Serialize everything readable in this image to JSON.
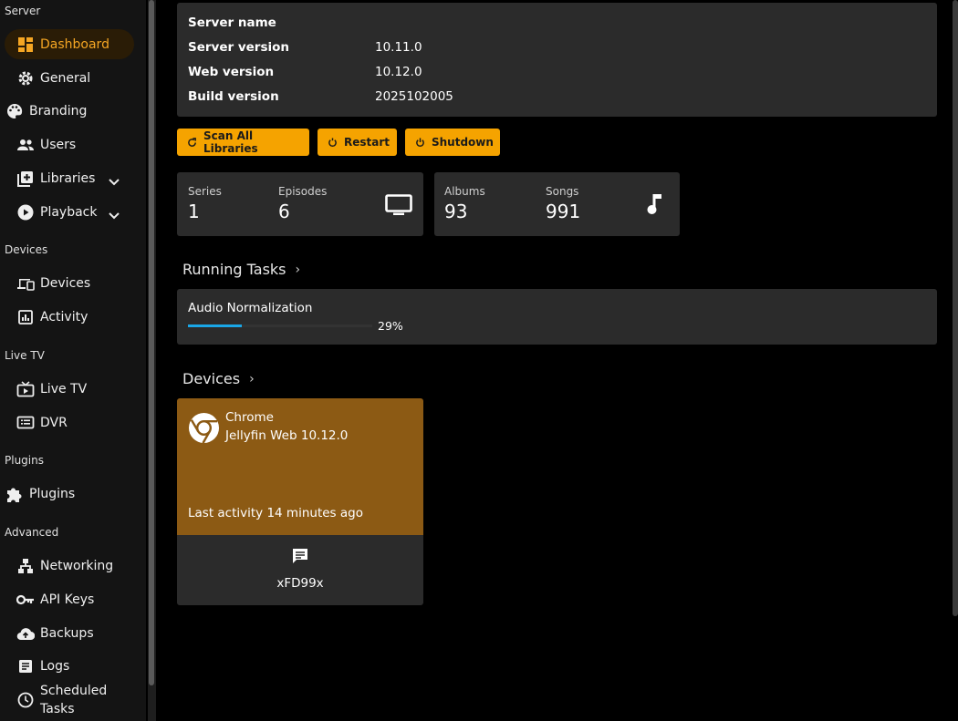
{
  "sidebar": {
    "sections": {
      "server": "Server",
      "devices": "Devices",
      "livetv": "Live TV",
      "plugins": "Plugins",
      "advanced": "Advanced"
    },
    "items": {
      "dashboard": "Dashboard",
      "general": "General",
      "branding": "Branding",
      "users": "Users",
      "libraries": "Libraries",
      "playback": "Playback",
      "devices": "Devices",
      "activity": "Activity",
      "livetv": "Live TV",
      "dvr": "DVR",
      "plugins": "Plugins",
      "networking": "Networking",
      "apikeys": "API Keys",
      "backups": "Backups",
      "logs": "Logs",
      "scheduled_line1": "Scheduled",
      "scheduled_line2": "Tasks"
    }
  },
  "server_info": {
    "name_label": "Server name",
    "version_label": "Server version",
    "version_value": "10.11.0",
    "web_label": "Web version",
    "web_value": "10.12.0",
    "build_label": "Build version",
    "build_value": "2025102005"
  },
  "actions": {
    "scan": "Scan All Libraries",
    "restart": "Restart",
    "shutdown": "Shutdown"
  },
  "stats": {
    "video": {
      "series_label": "Series",
      "series_value": "1",
      "episodes_label": "Episodes",
      "episodes_value": "6",
      "icon": "tv-icon"
    },
    "music": {
      "albums_label": "Albums",
      "albums_value": "93",
      "songs_label": "Songs",
      "songs_value": "991",
      "icon": "music-note-icon"
    }
  },
  "running_tasks": {
    "title": "Running Tasks",
    "task_name": "Audio Normalization",
    "progress": 0.29,
    "progress_text": "29%"
  },
  "devices": {
    "title": "Devices",
    "card": {
      "name": "Chrome",
      "app": "Jellyfin Web 10.12.0",
      "last_activity": "Last activity 14 minutes ago",
      "user": "xFD99x",
      "icon": "chrome-icon"
    }
  },
  "colors": {
    "accent": "#f5a300",
    "device_card": "#8c5a14",
    "progress": "#1aa7e8"
  }
}
